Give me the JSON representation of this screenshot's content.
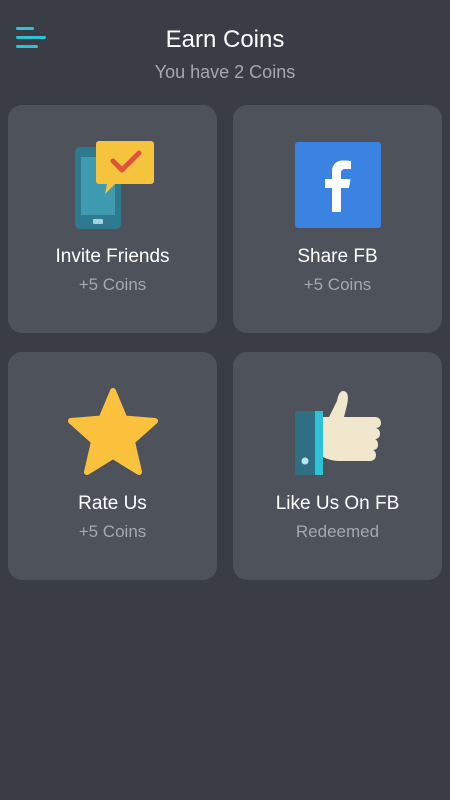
{
  "header": {
    "title": "Earn Coins",
    "subtitle": "You have 2 Coins",
    "menu_icon": "menu-icon"
  },
  "colors": {
    "background": "#3a3d45",
    "card": "#4d525b",
    "accent": "#2ac4d6",
    "facebook": "#3b83e3",
    "star": "#fdc23d",
    "muted_text": "#a5a8ae"
  },
  "cards": [
    {
      "label": "Invite Friends",
      "reward": "+5 Coins",
      "icon": "invite-phone-message-icon"
    },
    {
      "label": "Share FB",
      "reward": "+5 Coins",
      "icon": "facebook-icon"
    },
    {
      "label": "Rate Us",
      "reward": "+5 Coins",
      "icon": "star-icon"
    },
    {
      "label": "Like Us On FB",
      "reward": "Redeemed",
      "icon": "thumbs-up-icon"
    }
  ]
}
